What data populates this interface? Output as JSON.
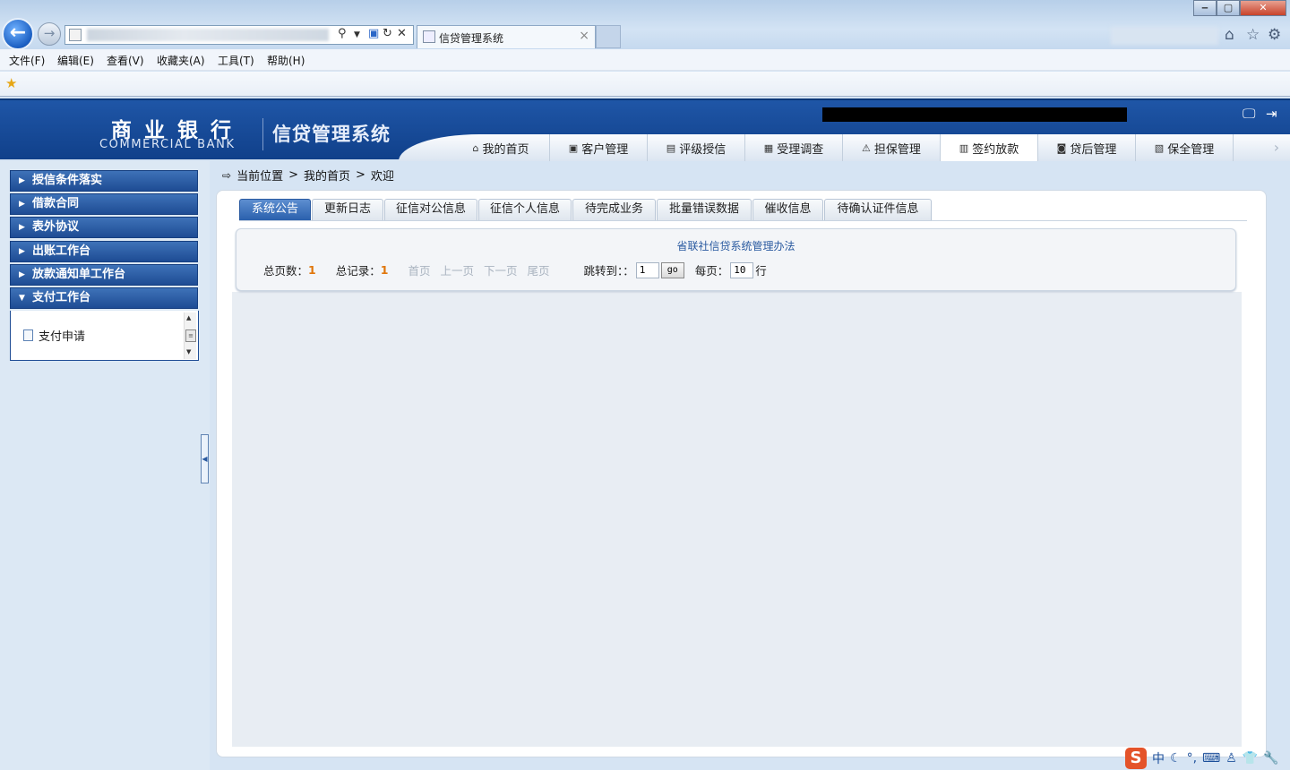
{
  "browser": {
    "tab_title": "信贷管理系统",
    "tab_close": "×",
    "menu": [
      "文件(F)",
      "编辑(E)",
      "查看(V)",
      "收藏夹(A)",
      "工具(T)",
      "帮助(H)"
    ],
    "back_glyph": "←",
    "forward_glyph": "→",
    "win_min": "‒",
    "win_max": "▢",
    "win_close": "✕",
    "icons": [
      "home-icon",
      "star-icon",
      "gear-icon"
    ]
  },
  "header": {
    "brand_cn": "商业银行",
    "brand_en": "COMMERCIAL BANK",
    "system_title": "信贷管理系统",
    "nav": [
      {
        "label": "我的首页",
        "icon": "⌂"
      },
      {
        "label": "客户管理",
        "icon": "▣"
      },
      {
        "label": "评级授信",
        "icon": "▤"
      },
      {
        "label": "受理调查",
        "icon": "▦"
      },
      {
        "label": "担保管理",
        "icon": "⚠"
      },
      {
        "label": "签约放款",
        "icon": "▥"
      },
      {
        "label": "贷后管理",
        "icon": "◙"
      },
      {
        "label": "保全管理",
        "icon": "▧"
      }
    ],
    "active_nav": "签约放款",
    "more_glyph": "›"
  },
  "sidebar": {
    "items": [
      "授信条件落实",
      "借款合同",
      "表外协议",
      "出账工作台",
      "放款通知单工作台",
      "支付工作台"
    ],
    "expanded_item": "支付工作台",
    "sub_items": [
      "支付申请"
    ]
  },
  "breadcrumb": {
    "prefix": "当前位置",
    "sep": ">",
    "path": [
      "我的首页",
      "欢迎"
    ]
  },
  "tabs": [
    "系统公告",
    "更新日志",
    "征信对公信息",
    "征信个人信息",
    "待完成业务",
    "批量错误数据",
    "催收信息",
    "待确认证件信息"
  ],
  "active_tab": "系统公告",
  "notice": {
    "title": "省联社信贷系统管理办法"
  },
  "pager": {
    "total_pages_label": "总页数：",
    "total_pages": "1",
    "total_records_label": "总记录：",
    "total_records": "1",
    "first": "首页",
    "prev": "上一页",
    "next": "下一页",
    "last": "尾页",
    "jump_label": "跳转到：：",
    "jump_value": "1",
    "go": "go",
    "per_page_label": "每页：",
    "per_page_value": "10",
    "per_page_unit": "行"
  },
  "tray": {
    "ime_logo": "S",
    "ime_lang": "中"
  },
  "colors": {
    "header_blue": "#1a4f9e",
    "accent_orange": "#e0760b",
    "notice_blue": "#2a5aa0"
  }
}
